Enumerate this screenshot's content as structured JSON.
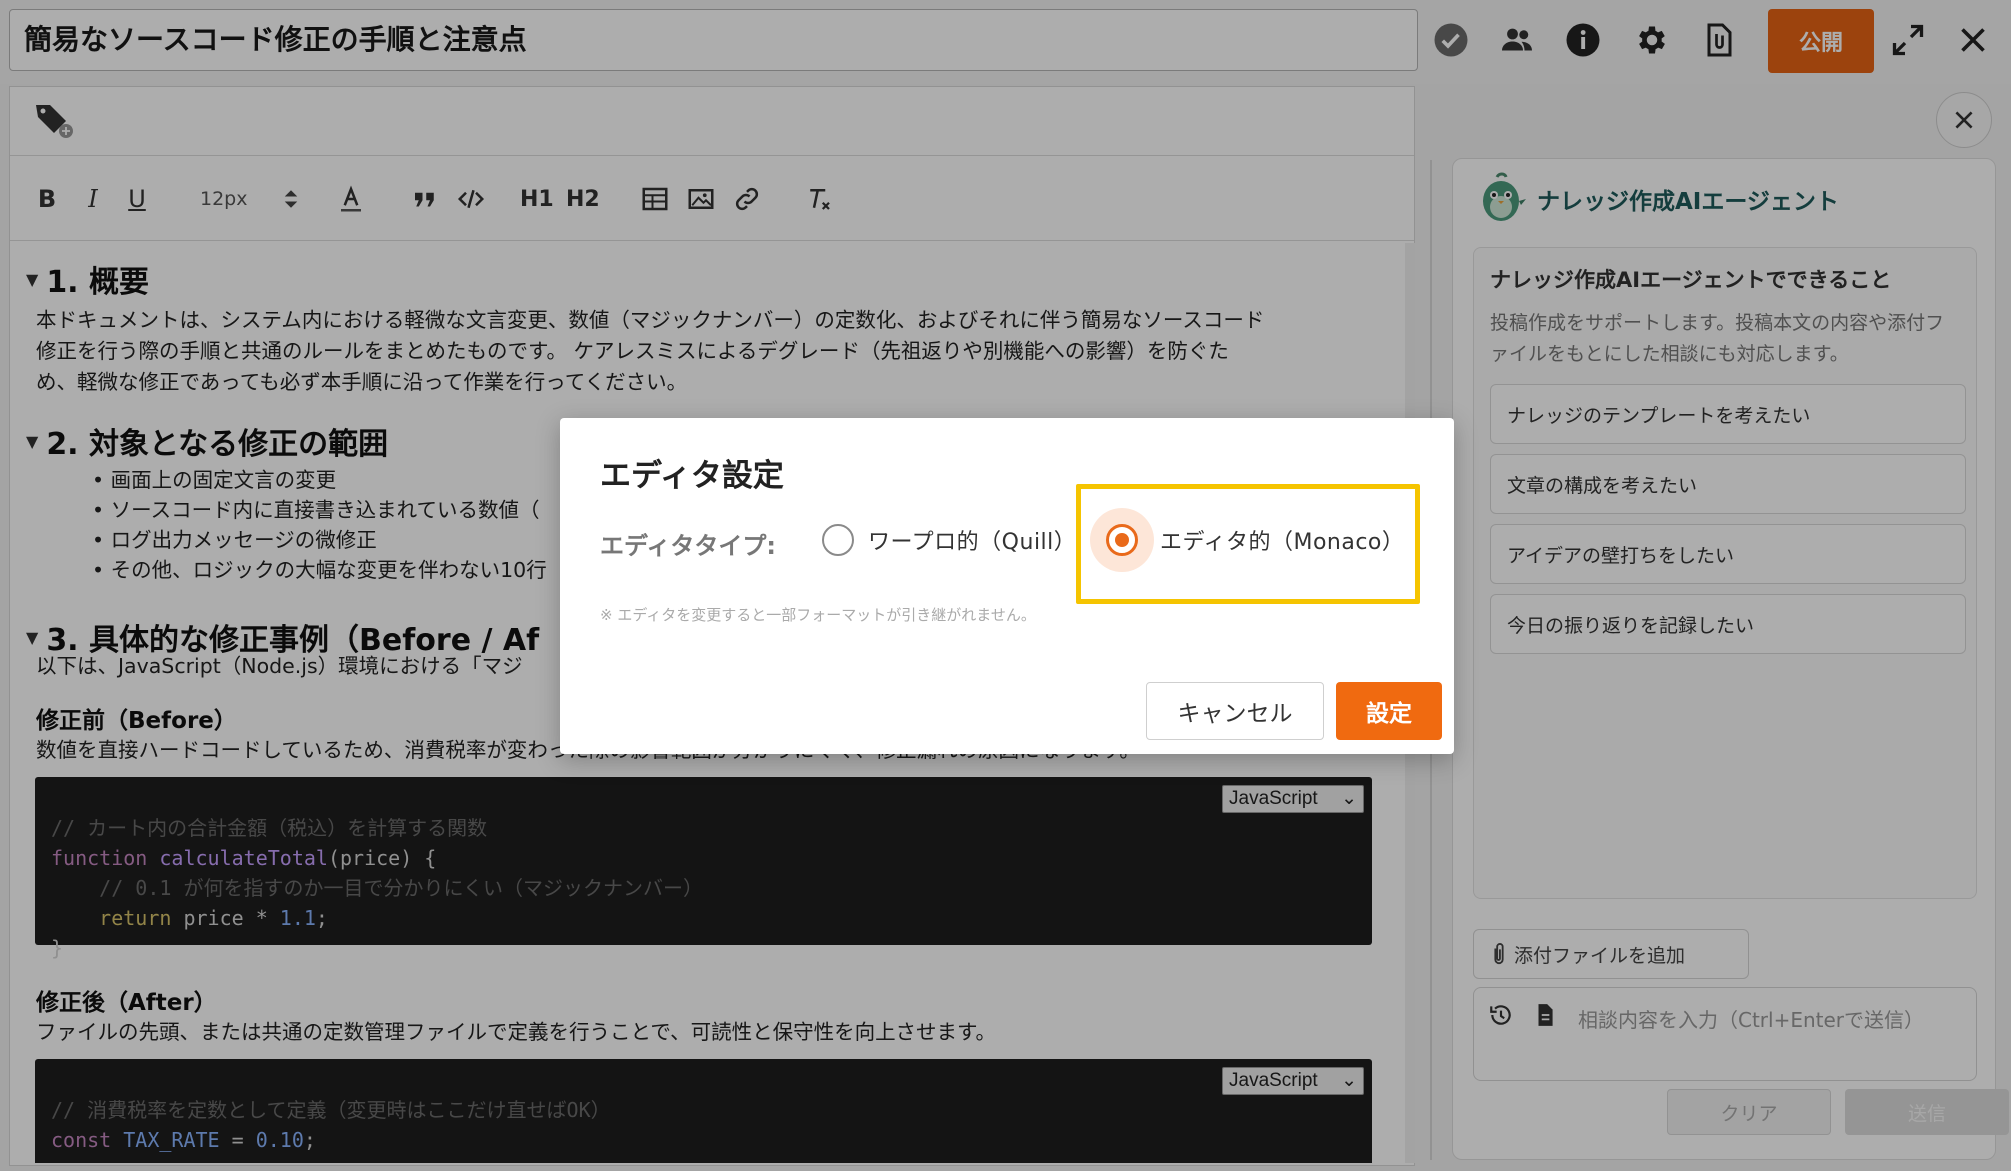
{
  "header": {
    "title": "簡易なソースコード修正の手順と注意点",
    "publish_label": "公開"
  },
  "toolbar": {
    "bold": "B",
    "italic": "I",
    "underline": "U",
    "font_size": "12px",
    "heading1": "H1",
    "heading2": "H2"
  },
  "doc": {
    "s1_title": "1. 概要",
    "s1_p1": "本ドキュメントは、システム内における軽微な文言変更、数値（マジックナンバー）の定数化、およびそれに伴う簡易なソースコード",
    "s1_p2": "修正を行う際の手順と共通のルールをまとめたものです。 ケアレスミスによるデグレード（先祖返りや別機能への影響）を防ぐた",
    "s1_p3": "め、軽微な修正であっても必ず本手順に沿って作業を行ってください。",
    "s2_title": "2. 対象となる修正の範囲",
    "s2_items": [
      "画面上の固定文言の変更",
      "ソースコード内に直接書き込まれている数値（",
      "ログ出力メッセージの微修正",
      "その他、ロジックの大幅な変更を伴わない10行"
    ],
    "s3_title": "3. 具体的な修正事例（Before / Af",
    "s3_p": "以下は、JavaScript（Node.js）環境における「マジ",
    "before_title": "修正前（Before）",
    "before_desc": "数値を直接ハードコードしているため、消費税率が変わった際の影響範囲が分かりにくく、修正漏れの原因になります。",
    "code1": {
      "l1": "// カート内の合計金額（税込）を計算する関数",
      "l2_kw": "function",
      "l2_fn": "calculateTotal",
      "l2_rest": "(price) {",
      "l3": "// 0.1 が何を指すのか一目で分かりにくい（マジックナンバー）",
      "l4_kw": "return",
      "l4_mid": "price * ",
      "l4_num": "1.1",
      "l4_end": ";",
      "l5": "}",
      "lang": "JavaScript"
    },
    "after_title": "修正後（After）",
    "after_desc": "ファイルの先頭、または共通の定数管理ファイルで定義を行うことで、可読性と保守性を向上させます。",
    "code2": {
      "l1": "// 消費税率を定数として定義（変更時はここだけ直せばOK）",
      "l2_kw": "const",
      "l2_name": "TAX_RATE",
      "l2_eq": " = ",
      "l2_num": "0.10",
      "l2_end": ";",
      "lang": "JavaScript"
    }
  },
  "agent": {
    "title": "ナレッジ作成AIエージェント",
    "cap_title": "ナレッジ作成AIエージェントでできること",
    "cap_desc": "投稿作成をサポートします。投稿本文の内容や添付ファイルをもとにした相談にも対応します。",
    "suggestions": [
      "ナレッジのテンプレートを考えたい",
      "文章の構成を考えたい",
      "アイデアの壁打ちをしたい",
      "今日の振り返りを記録したい"
    ],
    "attach_label": "添付ファイルを追加",
    "input_placeholder": "相談内容を入力（Ctrl+Enterで送信）",
    "clear_label": "クリア",
    "send_label": "送信"
  },
  "dialog": {
    "title": "エディタ設定",
    "type_label": "エディタタイプ:",
    "option_quill": "ワープロ的（Quill）",
    "option_monaco": "エディタ的（Monaco）",
    "selected": "monaco",
    "note": "※ エディタを変更すると一部フォーマットが引き継がれません。",
    "cancel_label": "キャンセル",
    "ok_label": "設定"
  },
  "colors": {
    "accent": "#e66414",
    "highlight": "#f5c400",
    "agent_title": "#1e5a5a"
  }
}
